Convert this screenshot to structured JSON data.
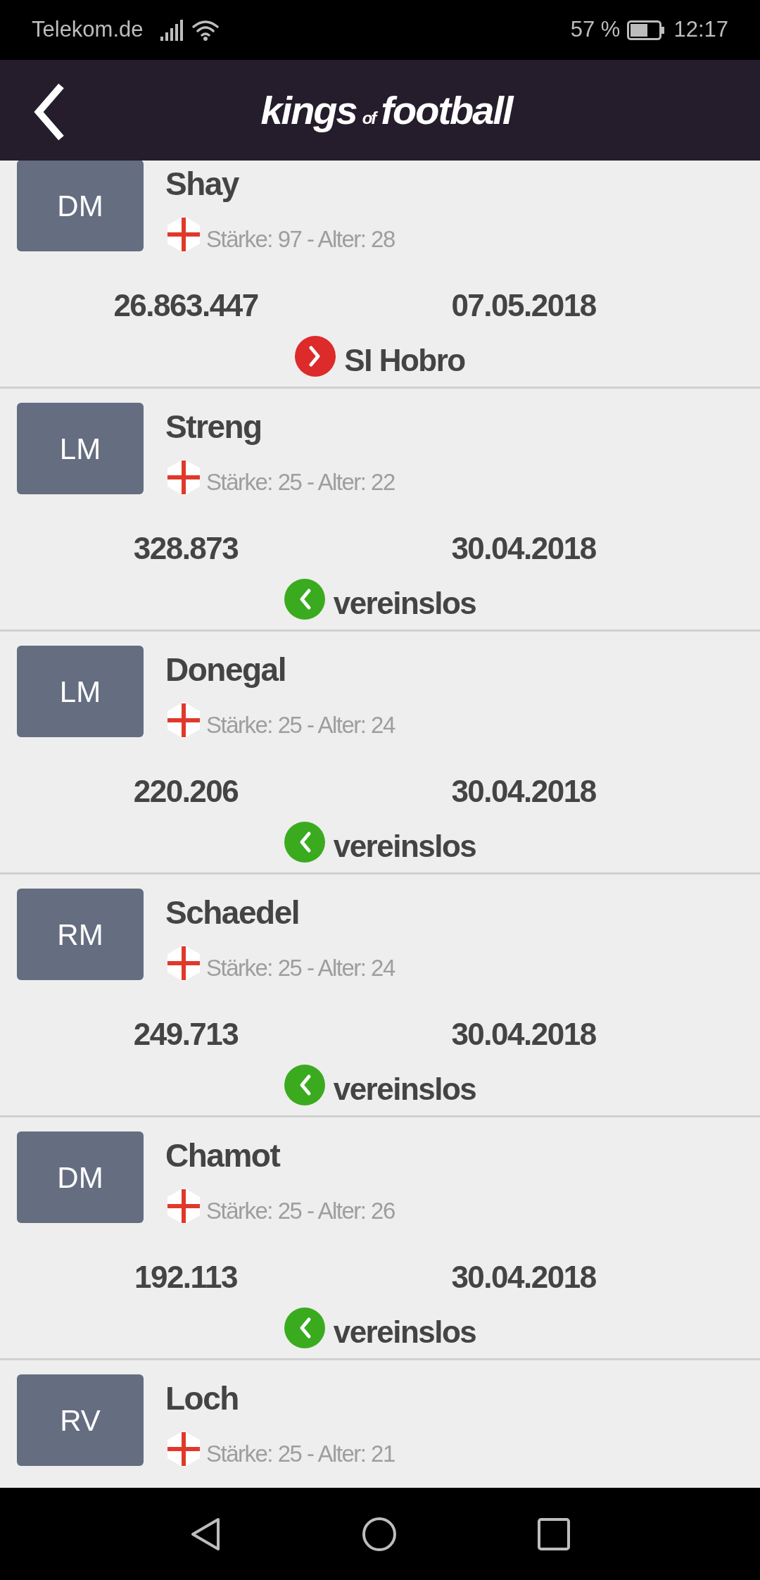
{
  "status_bar": {
    "carrier": "Telekom.de",
    "battery": "57 %",
    "time": "12:17"
  },
  "header": {
    "logo": {
      "first": "kings",
      "middle": "of",
      "last": "football"
    }
  },
  "players": [
    {
      "position": "DM",
      "name": "Shay",
      "stats": "Stärke: 97 - Alter: 28",
      "value": "26.863.447",
      "date": "07.05.2018",
      "club": "SI Hobro",
      "outgoing": true
    },
    {
      "position": "LM",
      "name": "Streng",
      "stats": "Stärke: 25 - Alter: 22",
      "value": "328.873",
      "date": "30.04.2018",
      "club": "vereinslos",
      "outgoing": false
    },
    {
      "position": "LM",
      "name": "Donegal",
      "stats": "Stärke: 25 - Alter: 24",
      "value": "220.206",
      "date": "30.04.2018",
      "club": "vereinslos",
      "outgoing": false
    },
    {
      "position": "RM",
      "name": "Schaedel",
      "stats": "Stärke: 25 - Alter: 24",
      "value": "249.713",
      "date": "30.04.2018",
      "club": "vereinslos",
      "outgoing": false
    },
    {
      "position": "DM",
      "name": "Chamot",
      "stats": "Stärke: 25 - Alter: 26",
      "value": "192.113",
      "date": "30.04.2018",
      "club": "vereinslos",
      "outgoing": false
    },
    {
      "position": "RV",
      "name": "Loch",
      "stats": "Stärke: 25 - Alter: 21"
    }
  ]
}
